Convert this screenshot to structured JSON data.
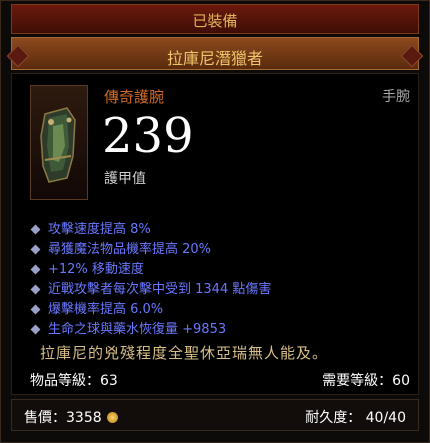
{
  "header": {
    "equipped_label": "已裝備",
    "item_name": "拉庫尼潛獵者"
  },
  "item": {
    "type_label": "傳奇護腕",
    "slot_label": "手腕",
    "armor_value": "239",
    "armor_label": "護甲值",
    "icon": "bracer-icon"
  },
  "affixes": [
    "攻擊速度提高 8%",
    "尋獲魔法物品機率提高 20%",
    "+12% 移動速度",
    "近戰攻擊者每次擊中受到 1344 點傷害",
    "爆擊機率提高 6.0%",
    "生命之球與藥水恢復量 +9853"
  ],
  "flavor_text": "拉庫尼的兇殘程度全聖休亞瑞無人能及。",
  "levels": {
    "item_level": "物品等級：63",
    "required_level": "需要等級：60"
  },
  "footer": {
    "sell_value": "售價：3358",
    "durability": "耐久度： 40/40"
  },
  "colors": {
    "legendary": "#d06a25",
    "affix": "#6a78ff",
    "flavor": "#d8bf86",
    "title": "#f0c46c"
  }
}
